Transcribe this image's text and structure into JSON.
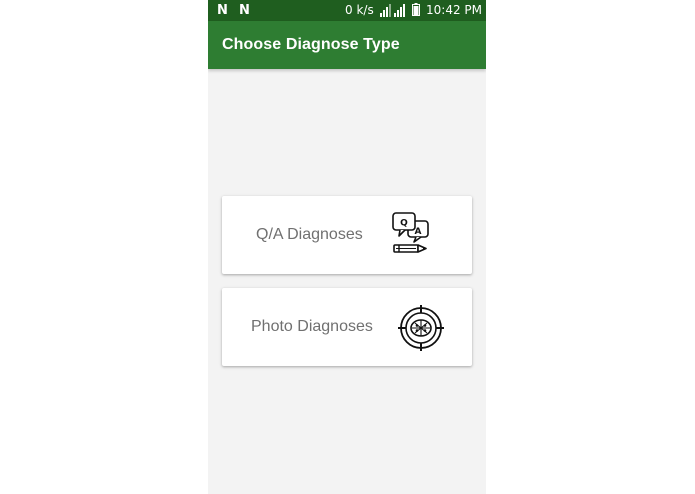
{
  "status_bar": {
    "notification_icons": [
      "N",
      "N"
    ],
    "network_speed": "0 k/s",
    "time": "10:42 PM"
  },
  "app_bar": {
    "title": "Choose Diagnose Type"
  },
  "options": [
    {
      "label": "Q/A Diagnoses",
      "icon": "qa-chat-pencil-icon",
      "icon_letters": [
        "Q",
        "A"
      ]
    },
    {
      "label": "Photo Diagnoses",
      "icon": "target-crosshair-icon"
    }
  ],
  "colors": {
    "status_bar": "#1f5e1f",
    "app_bar": "#2e7d32",
    "background": "#f3f3f3",
    "card_text": "#707070"
  }
}
